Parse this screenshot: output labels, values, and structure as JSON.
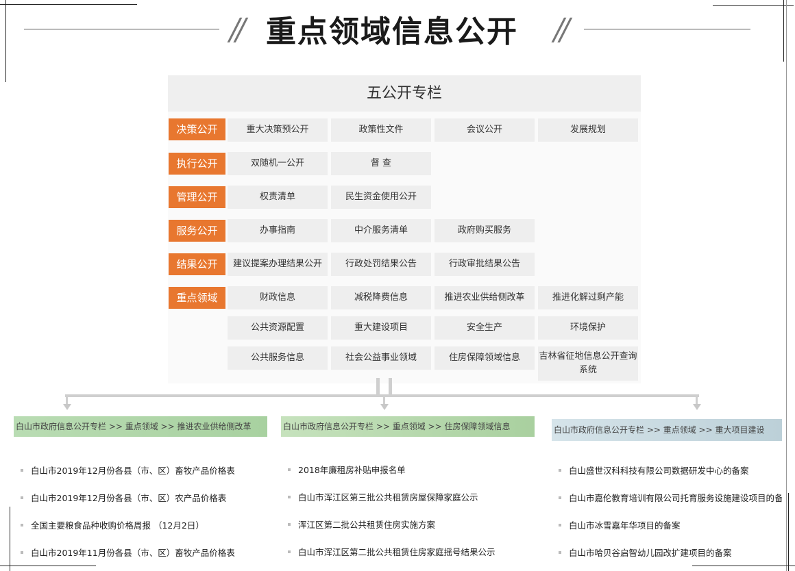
{
  "header": {
    "title": "重点领域信息公开",
    "slash": "//"
  },
  "panel": {
    "title": "五公开专栏",
    "rows": [
      {
        "category": "决策公开",
        "items": [
          "重大决策预公开",
          "政策性文件",
          "会议公开",
          "发展规划"
        ]
      },
      {
        "category": "执行公开",
        "items": [
          "双随机一公开",
          "督 查"
        ]
      },
      {
        "category": "管理公开",
        "items": [
          "权责清单",
          "民生资金使用公开"
        ]
      },
      {
        "category": "服务公开",
        "items": [
          "办事指南",
          "中介服务清单",
          "政府购买服务"
        ]
      },
      {
        "category": "结果公开",
        "items": [
          "建议提案办理结果公开",
          "行政处罚结果公告",
          "行政审批结果公告"
        ]
      },
      {
        "category": "重点领域",
        "items": [
          "财政信息",
          "减税降费信息",
          "推进农业供给侧改革",
          "推进化解过剩产能"
        ]
      },
      {
        "category": "",
        "items": [
          "公共资源配置",
          "重大建设项目",
          "安全生产",
          "环境保护"
        ]
      },
      {
        "category": "",
        "items": [
          "公共服务信息",
          "社会公益事业领域",
          "住房保障领域信息",
          "吉林省征地信息公开查询系统"
        ]
      }
    ]
  },
  "columns": [
    {
      "breadcrumb": "白山市政府信息公开专栏 >> 重点领域 >> 推进农业供给侧改革",
      "items": [
        "白山市2019年12月份各县（市、区）畜牧产品价格表",
        "白山市2019年12月份各县（市、区）农产品价格表",
        "全国主要粮食品种收购价格周报 （12月2日）",
        "白山市2019年11月份各县（市、区）畜牧产品价格表"
      ]
    },
    {
      "breadcrumb": "白山市政府信息公开专栏 >> 重点领域 >> 住房保障领域信息",
      "items": [
        "2018年廉租房补贴申报名单",
        "白山市浑江区第三批公共租赁房屋保障家庭公示",
        "浑江区第二批公共租赁住房实施方案",
        "白山市浑江区第二批公共租赁住房家庭摇号结果公示"
      ]
    },
    {
      "breadcrumb": "白山市政府信息公开专栏 >> 重点领域 >> 重大项目建设",
      "items": [
        "白山盛世汉科科技有限公司数据研发中心的备案",
        "白山市嘉伦教育培训有限公司托育服务设施建设项目的备案",
        "白山市冰雪嘉年华项目的备案",
        "白山市哈贝谷启智幼儿园改扩建项目的备案"
      ]
    }
  ],
  "colors": {
    "accent": "#e8772f",
    "cell": "#eeeeee",
    "panel_head": "#efefef",
    "connector": "#cfcfcf"
  }
}
